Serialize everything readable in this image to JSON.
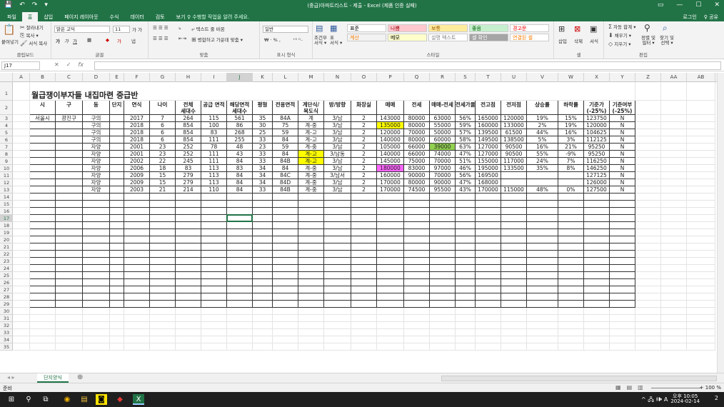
{
  "window": {
    "title": "(중급)아파트리스트 - 제출 - Excel (제품 인증 실패)",
    "controls": [
      "▭",
      "—",
      "☐",
      "✕"
    ]
  },
  "menu": {
    "tabs": [
      "파일",
      "홈",
      "삽입",
      "페이지 레이아웃",
      "수식",
      "데이터",
      "검토",
      "보기"
    ],
    "active_tab": "홈",
    "search_placeholder": "♀ 수행할 작업을 알려 주세요.",
    "login": "로그인",
    "share": "♀ 공유"
  },
  "ribbon": {
    "clipboard": {
      "label": "클립보드",
      "paste": "붙여넣기",
      "cut": "잘라내기",
      "copy": "복사 ▾",
      "format_painter": "서식 복사"
    },
    "font": {
      "label": "글꼴",
      "font_name": "맑은 고딕",
      "font_size": "11"
    },
    "alignment": {
      "label": "맞춤",
      "wrap": "텍스트 줄 바꿈",
      "merge": "병합하고 가운데 맞춤 ▾"
    },
    "number": {
      "label": "표시 형식",
      "format": "일반"
    },
    "styles": {
      "label": "스타일",
      "conditional": "조건부\n서식 ▾",
      "table": "표\n서식 ▾",
      "cells": [
        {
          "text": "표준",
          "bg": "#ffffff",
          "fg": "#000000"
        },
        {
          "text": "나쁨",
          "bg": "#ffc7ce",
          "fg": "#9c0006"
        },
        {
          "text": "보통",
          "bg": "#ffeb9c",
          "fg": "#9c5700"
        },
        {
          "text": "좋음",
          "bg": "#c6efce",
          "fg": "#006100"
        },
        {
          "text": "경고문",
          "bg": "#ffffff",
          "fg": "#ff0000"
        },
        {
          "text": "계산",
          "bg": "#f2f2f2",
          "fg": "#fa7d00"
        },
        {
          "text": "메모",
          "bg": "#ffffcc",
          "fg": "#000000"
        },
        {
          "text": "설명 텍스트",
          "bg": "#ffffff",
          "fg": "#7f7f7f"
        },
        {
          "text": "셀 확인",
          "bg": "#a5a5a5",
          "fg": "#ffffff"
        },
        {
          "text": "연결된 셀",
          "bg": "#ffffff",
          "fg": "#fa7d00"
        }
      ]
    },
    "cells": {
      "label": "셀",
      "insert": "삽입",
      "delete": "삭제",
      "format": "서식"
    },
    "editing": {
      "label": "편집",
      "autosum": "자동 합계 ▾",
      "fill": "채우기 ▾",
      "clear": "지우기 ▾",
      "sort": "정렬 및\n필터 ▾",
      "find": "찾기 및\n선택 ▾"
    }
  },
  "formula_bar": {
    "name_box": "J17",
    "fx": "fx",
    "value": ""
  },
  "sheet": {
    "column_letters": [
      "A",
      "B",
      "C",
      "D",
      "E",
      "F",
      "G",
      "H",
      "I",
      "J",
      "K",
      "L",
      "M",
      "N",
      "O",
      "P",
      "Q",
      "R",
      "S",
      "T",
      "U",
      "V",
      "W",
      "X",
      "Y",
      "Z",
      "AA",
      "AB"
    ],
    "selected_column": "J",
    "selected_row": 17,
    "title": "월급쟁이부자들 내집마련 중급반",
    "headers": [
      "시",
      "구",
      "동",
      "단지",
      "연식",
      "나이",
      "전체\n세대수",
      "공급 면적",
      "해당면적\n세대수",
      "평형",
      "전용면적",
      "계단식/\n복도식",
      "방/방향",
      "화장실",
      "매매",
      "전세",
      "매매-전세",
      "전세가율",
      "전고점",
      "전저점",
      "상승률",
      "하락률",
      "기준가\n(-25%)",
      "기준여부\n(-25%)"
    ],
    "rows": [
      [
        "서울시",
        "광진구",
        "구의",
        "",
        "2017",
        "7",
        "264",
        "115",
        "561",
        "35",
        "84A",
        "계",
        "3/남",
        "2",
        "143000",
        "80000",
        "63000",
        "56%",
        "165000",
        "120000",
        "19%",
        "15%",
        "123750",
        "N"
      ],
      [
        "",
        "",
        "구의",
        "",
        "2018",
        "6",
        "854",
        "100",
        "86",
        "30",
        "75",
        "계-중",
        "3/남",
        "2",
        "135000",
        "80000",
        "55000",
        "59%",
        "160000",
        "133000",
        "2%",
        "19%",
        "120000",
        "N"
      ],
      [
        "",
        "",
        "구의",
        "",
        "2018",
        "6",
        "854",
        "83",
        "268",
        "25",
        "59",
        "계-고",
        "3/남",
        "2",
        "120000",
        "70000",
        "50000",
        "57%",
        "139500",
        "61500",
        "44%",
        "16%",
        "104625",
        "N"
      ],
      [
        "",
        "",
        "구의",
        "",
        "2018",
        "6",
        "854",
        "111",
        "255",
        "33",
        "84",
        "계-고",
        "3/남",
        "2",
        "140000",
        "80000",
        "60000",
        "58%",
        "149500",
        "138500",
        "5%",
        "3%",
        "112125",
        "N"
      ],
      [
        "",
        "",
        "자양",
        "",
        "2001",
        "23",
        "252",
        "78",
        "48",
        "23",
        "59",
        "계-중",
        "3/남",
        "2",
        "105000",
        "66000",
        "39000",
        "63%",
        "127000",
        "90500",
        "16%",
        "21%",
        "95250",
        "N"
      ],
      [
        "",
        "",
        "자양",
        "",
        "2001",
        "23",
        "252",
        "111",
        "43",
        "33",
        "84",
        "계-고",
        "3/남동",
        "2",
        "140000",
        "66000",
        "74000",
        "47%",
        "127000",
        "90500",
        "55%",
        "-9%",
        "95250",
        "N"
      ],
      [
        "",
        "",
        "자양",
        "",
        "2002",
        "22",
        "245",
        "111",
        "84",
        "33",
        "84B",
        "계-고",
        "3/남",
        "2",
        "145000",
        "75000",
        "70000",
        "51%",
        "155000",
        "117000",
        "24%",
        "7%",
        "116250",
        "N"
      ],
      [
        "",
        "",
        "자양",
        "",
        "2006",
        "18",
        "83",
        "113",
        "83",
        "34",
        "84",
        "계-중",
        "3/남",
        "2",
        "180000",
        "83000",
        "97000",
        "46%",
        "195000",
        "133500",
        "35%",
        "8%",
        "146250",
        "N"
      ],
      [
        "",
        "",
        "자양",
        "",
        "2009",
        "15",
        "279",
        "113",
        "84",
        "34",
        "84C",
        "계-중",
        "3/남서",
        "2",
        "160000",
        "90000",
        "70000",
        "56%",
        "169500",
        "",
        "",
        "",
        "127125",
        "N"
      ],
      [
        "",
        "",
        "자양",
        "",
        "2009",
        "15",
        "279",
        "113",
        "84",
        "34",
        "84D",
        "계-중",
        "3/남",
        "2",
        "170000",
        "80000",
        "90000",
        "47%",
        "168000",
        "",
        "",
        "",
        "126000",
        "N"
      ],
      [
        "",
        "",
        "자양",
        "",
        "2003",
        "21",
        "214",
        "110",
        "84",
        "33",
        "84B",
        "계-중",
        "3/남",
        "2",
        "170000",
        "74500",
        "95500",
        "43%",
        "170000",
        "115000",
        "48%",
        "0%",
        "127500",
        "N"
      ]
    ],
    "highlights": [
      {
        "row": 4,
        "col": "P",
        "color": "#ffff00"
      },
      {
        "row": 7,
        "col": "R",
        "color": "#92d050"
      },
      {
        "row": 8,
        "col": "M",
        "color": "#ffff00"
      },
      {
        "row": 9,
        "col": "M",
        "color": "#ffff00"
      },
      {
        "row": 10,
        "col": "P",
        "color": "#ff66ff"
      }
    ]
  },
  "sheet_tabs": {
    "active": "단지양식",
    "add": "⊕"
  },
  "status": {
    "ready": "준비",
    "zoom": "+ 100 %"
  },
  "taskbar": {
    "icons": [
      "⊞",
      "⚲",
      "⧉",
      "◉",
      "▤",
      "◙",
      "◆",
      "X"
    ],
    "time": "오후 10:05",
    "date": "2024-02-14",
    "tray": "^ 🖧 🕪 A",
    "notify": "2"
  }
}
